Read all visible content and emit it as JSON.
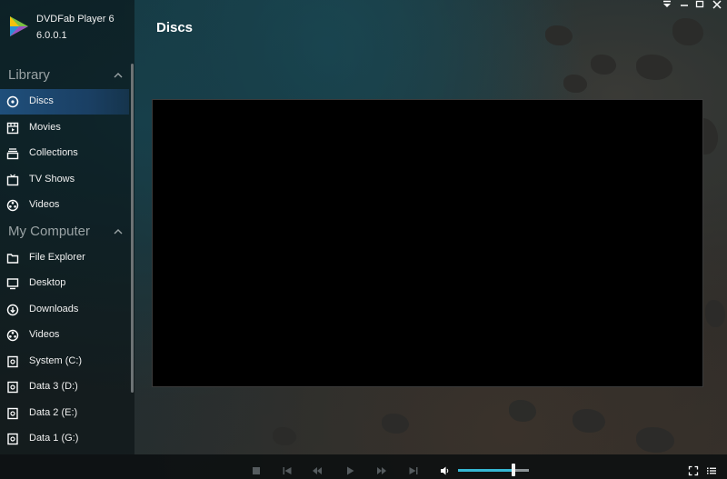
{
  "app": {
    "name": "DVDFab Player 6",
    "version": "6.0.0.1"
  },
  "sidebar": {
    "library": {
      "title": "Library",
      "items": [
        {
          "label": "Discs",
          "icon": "disc-icon",
          "active": true
        },
        {
          "label": "Movies",
          "icon": "movie-icon"
        },
        {
          "label": "Collections",
          "icon": "collections-icon"
        },
        {
          "label": "TV Shows",
          "icon": "tv-icon"
        },
        {
          "label": "Videos",
          "icon": "video-reel-icon"
        }
      ]
    },
    "computer": {
      "title": "My Computer",
      "items": [
        {
          "label": "File Explorer",
          "icon": "folder-icon"
        },
        {
          "label": "Desktop",
          "icon": "desktop-icon"
        },
        {
          "label": "Downloads",
          "icon": "download-icon"
        },
        {
          "label": "Videos",
          "icon": "video-reel-icon"
        },
        {
          "label": "System (C:)",
          "icon": "drive-icon"
        },
        {
          "label": "Data 3 (D:)",
          "icon": "drive-icon"
        },
        {
          "label": "Data 2 (E:)",
          "icon": "drive-icon"
        },
        {
          "label": "Data 1 (G:)",
          "icon": "drive-icon"
        }
      ]
    }
  },
  "main": {
    "title": "Discs"
  },
  "player": {
    "volume_fraction": 0.78,
    "accent_color": "#35b6d3",
    "active_nav_color": "#1f4f7b"
  }
}
